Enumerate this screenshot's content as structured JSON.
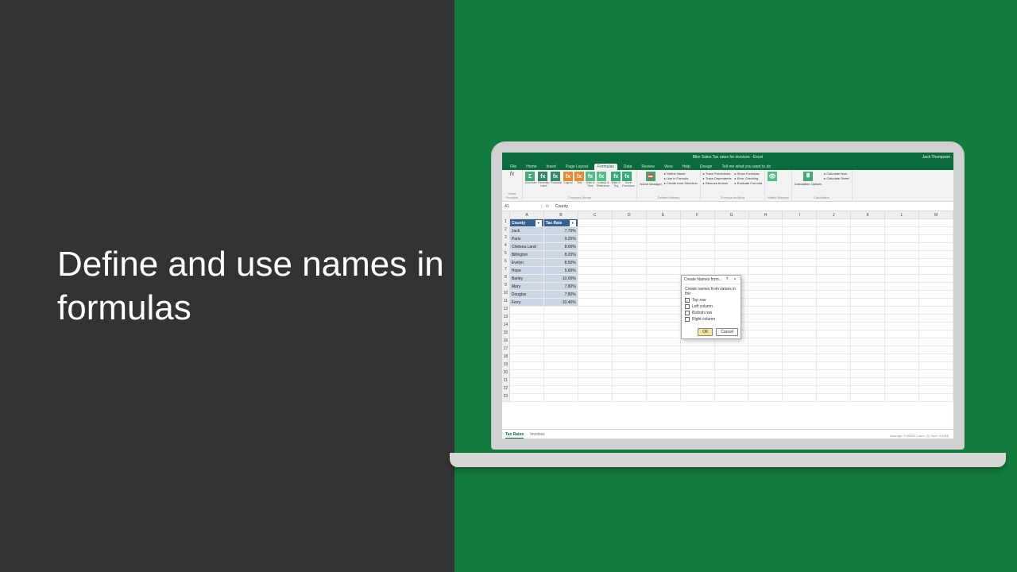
{
  "title": "Define and use names in formulas",
  "excel": {
    "title_center": "Bike Sales         Tax rates for invoices - Excel",
    "user": "Jack Thompson",
    "tabs": [
      "File",
      "Home",
      "Insert",
      "Page Layout",
      "Formulas",
      "Data",
      "Review",
      "View",
      "Help",
      "Design",
      "Tell me what you want to do"
    ],
    "active_tab": 4,
    "ribbon": {
      "fx_label": "Insert\nFunction",
      "group1": {
        "labels": [
          "AutoSum",
          "Recently\nUsed",
          "Financial",
          "Logical",
          "Text",
          "Date &\nTime",
          "Lookup &\nReference",
          "Math &\nTrig",
          "More\nFunctions"
        ],
        "caption": "Function Library"
      },
      "group2": {
        "label": "Name\nManager",
        "items": [
          "Define Name",
          "Use in Formula",
          "Create from Selection"
        ],
        "caption": "Defined Names"
      },
      "group3": {
        "items": [
          "Trace Precedents",
          "Trace Dependents",
          "Remove Arrows"
        ],
        "right": [
          "Show Formulas",
          "Error Checking",
          "Evaluate Formula"
        ],
        "caption": "Formula Auditing"
      },
      "group4": {
        "label": "Watch\nWindow"
      },
      "group5": {
        "label": "Calculation\nOptions",
        "items": [
          "Calculate Now",
          "Calculate Sheet"
        ],
        "caption": "Calculation"
      }
    },
    "namebox": "A1",
    "formula": "County",
    "columns": [
      "A",
      "B",
      "C",
      "D",
      "E",
      "F",
      "G",
      "H",
      "I",
      "J",
      "K",
      "L",
      "M"
    ],
    "table": {
      "headers": [
        "County",
        "Tax Rate"
      ],
      "rows": [
        [
          "Jack",
          "7.70%"
        ],
        [
          "Paris",
          "9.25%"
        ],
        [
          "Chelsea Land",
          "8.00%"
        ],
        [
          "Billington",
          "8.20%"
        ],
        [
          "Evelyn",
          "8.50%"
        ],
        [
          "Hope",
          "5.60%"
        ],
        [
          "Barley",
          "10.00%"
        ],
        [
          "Mary",
          "7.80%"
        ],
        [
          "Douglas",
          "7.80%"
        ],
        [
          "Ferry",
          "10.40%"
        ]
      ]
    },
    "empty_rows": [
      12,
      13,
      14,
      15,
      16,
      17,
      18,
      19,
      20,
      21,
      22,
      23
    ],
    "sheets": [
      "Tax Rates",
      "Invoices"
    ],
    "active_sheet": 0,
    "status": "Average: 0.08325   Count: 22   Sum: 0.8325"
  },
  "dialog": {
    "title": "Create Names from...",
    "help": "?",
    "close": "×",
    "prompt": "Create names from values in the:",
    "options": [
      {
        "label": "Top row",
        "checked": true
      },
      {
        "label": "Left column",
        "checked": false
      },
      {
        "label": "Bottom row",
        "checked": false
      },
      {
        "label": "Right column",
        "checked": false
      }
    ],
    "ok": "OK",
    "cancel": "Cancel"
  }
}
